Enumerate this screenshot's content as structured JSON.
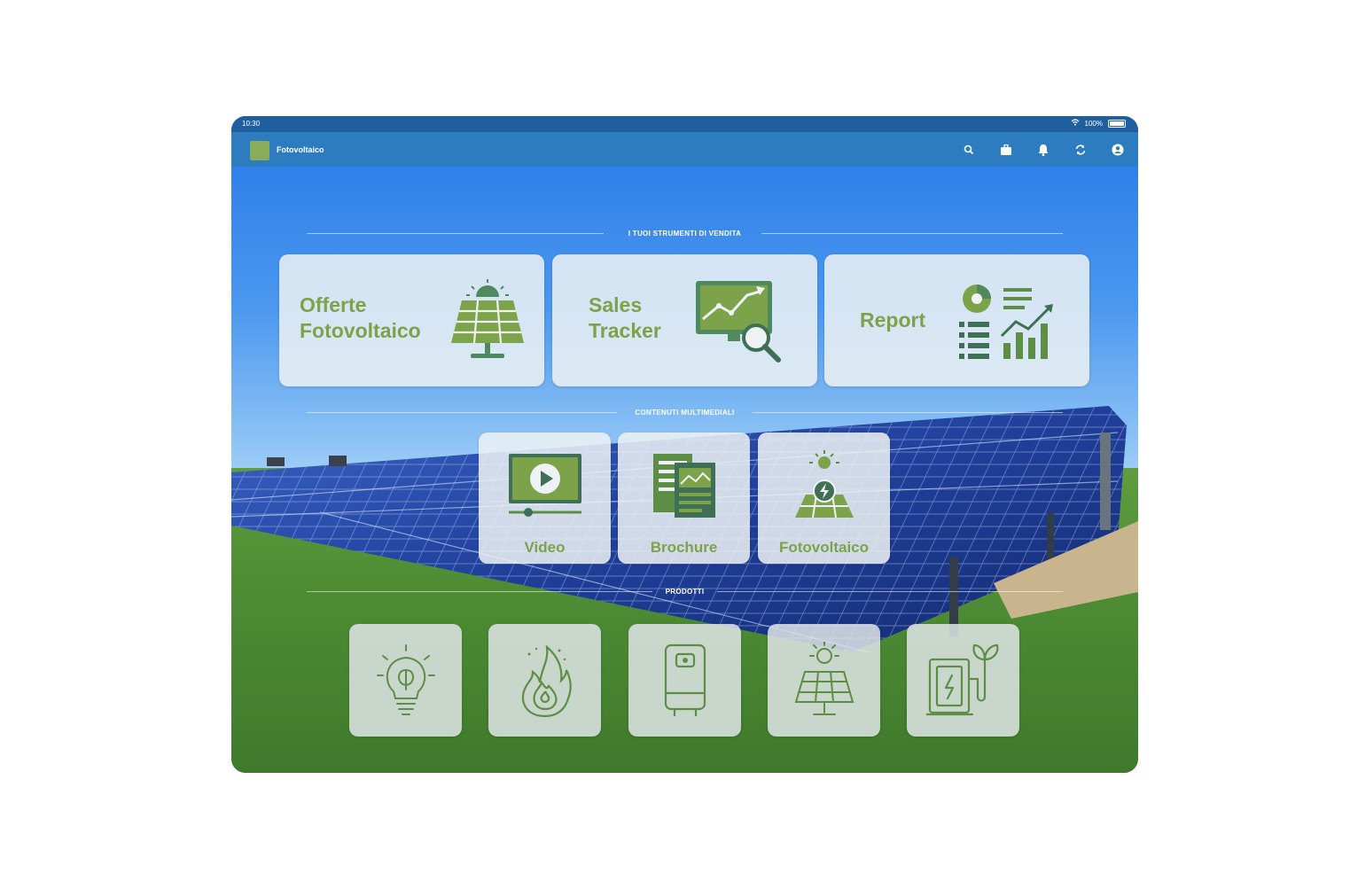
{
  "status_bar": {
    "time": "10:30",
    "battery": "100%"
  },
  "app_bar": {
    "title": "Fotovoltaico",
    "icons": [
      "search-icon",
      "briefcase-icon",
      "bell-icon",
      "sync-icon",
      "account-icon"
    ]
  },
  "sections": {
    "tools": {
      "title": "I TUOI STRUMENTI DI VENDITA"
    },
    "media": {
      "title": "CONTENUTI MULTIMEDIALI"
    },
    "products": {
      "title": "PRODOTTI"
    }
  },
  "tools": [
    {
      "line1": "Offerte",
      "line2": "Fotovoltaico",
      "icon": "solar-panel-icon"
    },
    {
      "line1": "Sales",
      "line2": "Tracker",
      "icon": "analytics-search-icon"
    },
    {
      "label": "Report",
      "icon": "report-chart-icon"
    }
  ],
  "media": [
    {
      "label": "Video",
      "icon": "video-play-icon"
    },
    {
      "label": "Brochure",
      "icon": "brochure-icon"
    },
    {
      "label": "Fotovoltaico",
      "icon": "solar-energy-icon"
    }
  ],
  "products": [
    {
      "icon": "eco-bulb-icon"
    },
    {
      "icon": "gas-flame-icon"
    },
    {
      "icon": "water-heater-icon"
    },
    {
      "icon": "solar-panel-sun-icon"
    },
    {
      "icon": "ev-charger-icon"
    }
  ],
  "colors": {
    "accent": "#7da34a",
    "appbar": "#2e7cc0",
    "statusbar": "#1f5f9f",
    "icon": "#5c8f45",
    "icon_dark": "#3f6f55"
  }
}
